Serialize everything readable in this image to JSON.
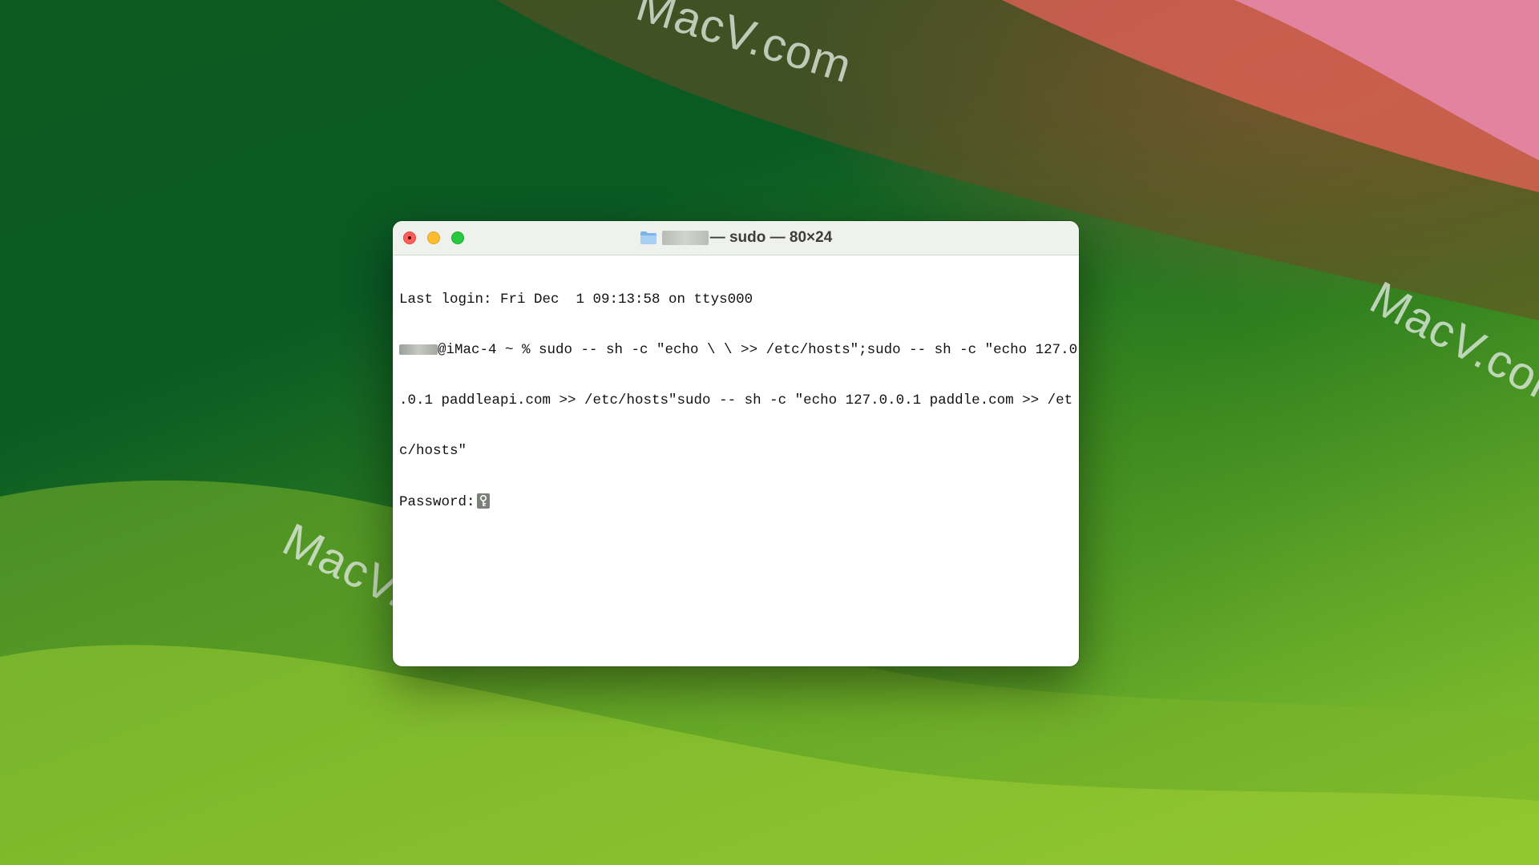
{
  "desktop": {
    "watermarks": [
      "MacV.com",
      "MacV.com",
      "MacV.com"
    ]
  },
  "window": {
    "title": "— sudo — 80×24",
    "terminal": {
      "line1": "Last login: Fri Dec  1 09:13:58 on ttys000",
      "line2": "@iMac-4 ~ % sudo -- sh -c \"echo \\ \\ >> /etc/hosts\";sudo -- sh -c \"echo 127.0",
      "line3": ".0.1 paddleapi.com >> /etc/hosts\"sudo -- sh -c \"echo 127.0.0.1 paddle.com >> /et",
      "line4": "c/hosts\"",
      "line5": "Password:"
    }
  },
  "colors": {
    "close": "#ff5f57",
    "minimize": "#febc2e",
    "maximize": "#28c840"
  },
  "icons": [
    "folder-icon",
    "key-icon"
  ]
}
